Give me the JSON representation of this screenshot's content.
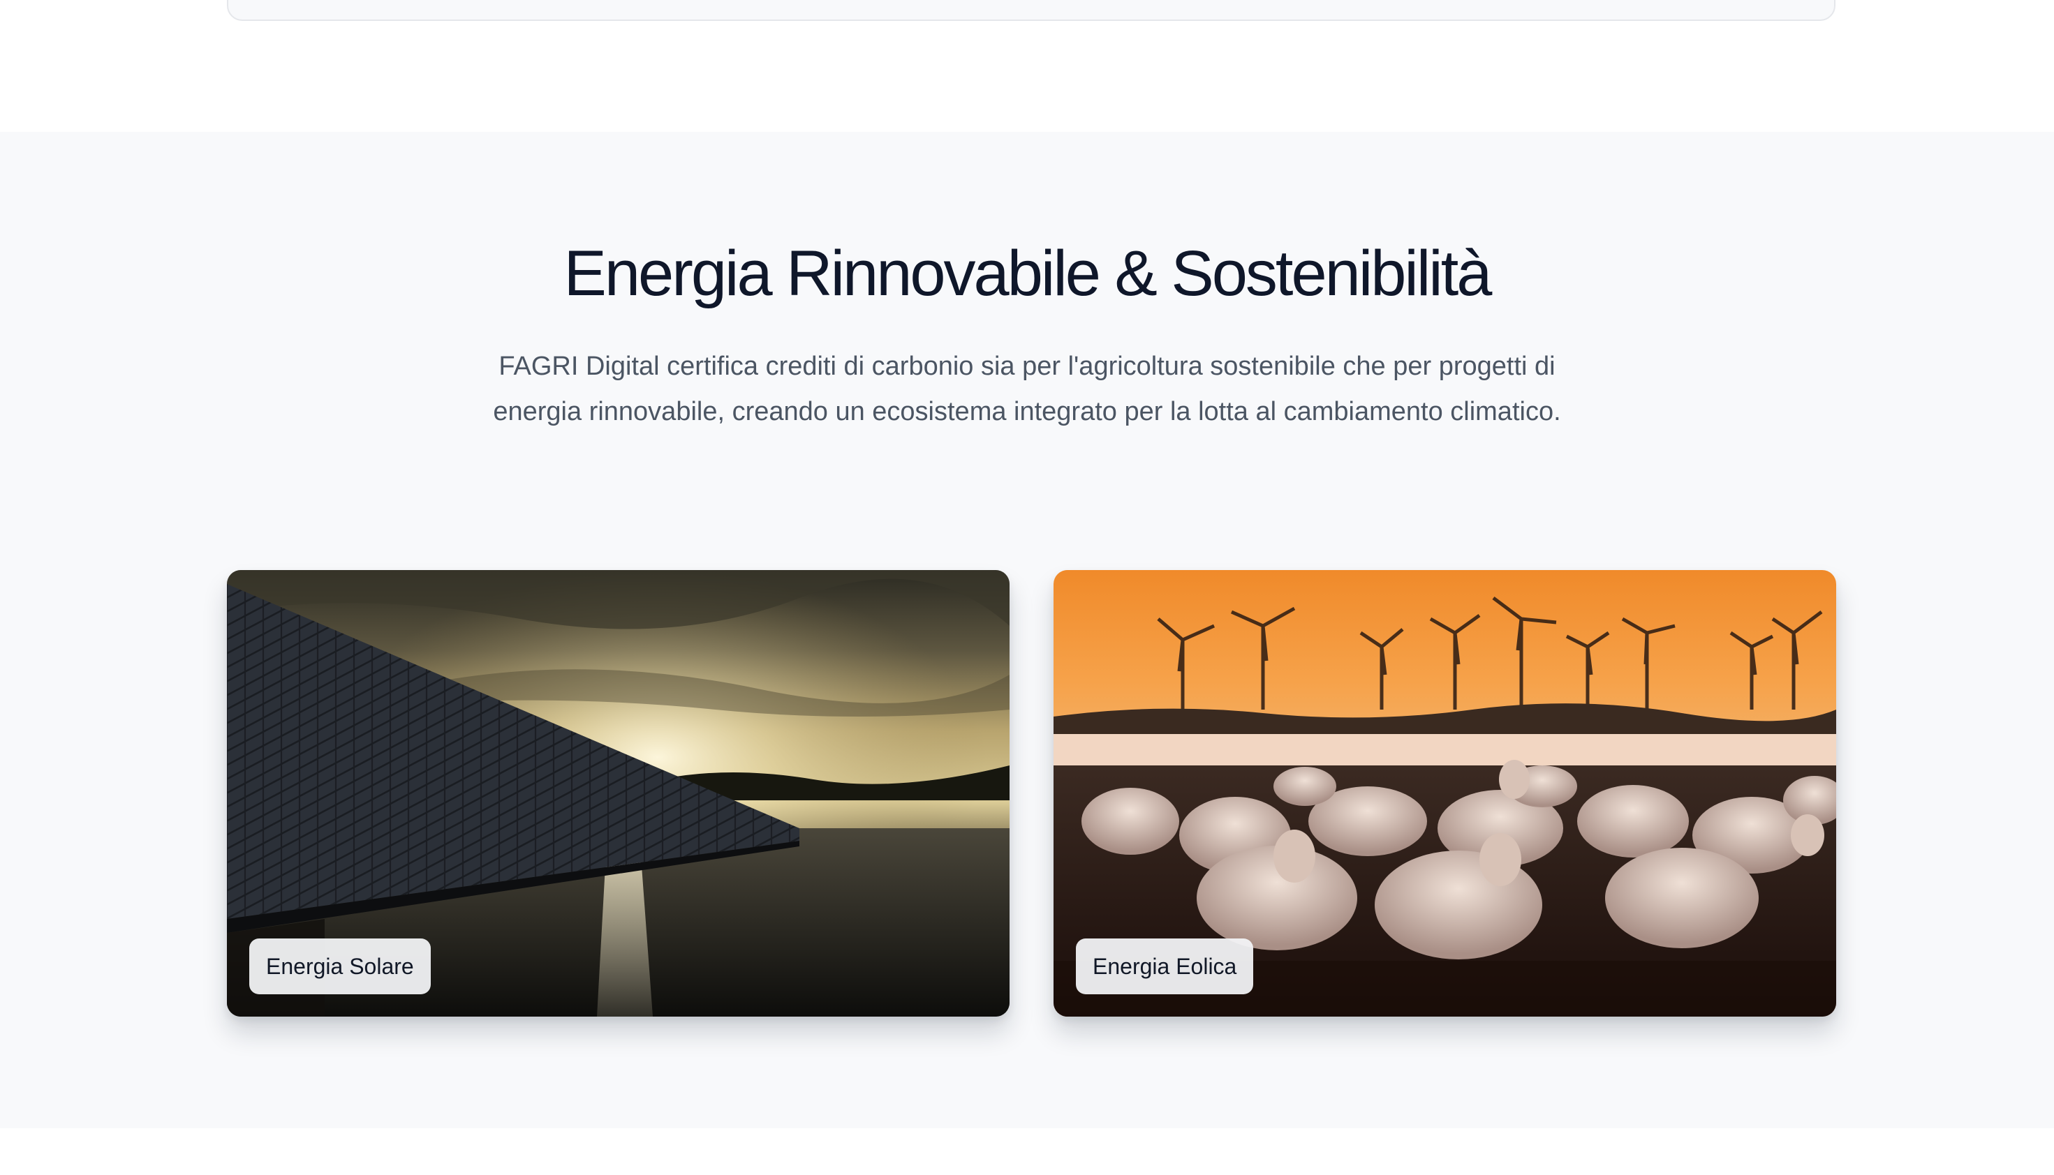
{
  "section": {
    "title": "Energia Rinnovabile & Sostenibilità",
    "description": "FAGRI Digital certifica crediti di carbonio sia per l'agricoltura sostenibile che per progetti di energia rinnovabile, creando un ecosistema integrato per la lotta al cambiamento climatico."
  },
  "cards": [
    {
      "label": "Energia Solare",
      "image": "solar-panels-sunset-photo"
    },
    {
      "label": "Energia Eolica",
      "image": "wind-turbines-sheep-photo"
    }
  ],
  "colors": {
    "section_background": "#f8f9fb",
    "heading": "#0f172a",
    "body_text": "#4b5563",
    "label_background": "#f3f4f6"
  }
}
